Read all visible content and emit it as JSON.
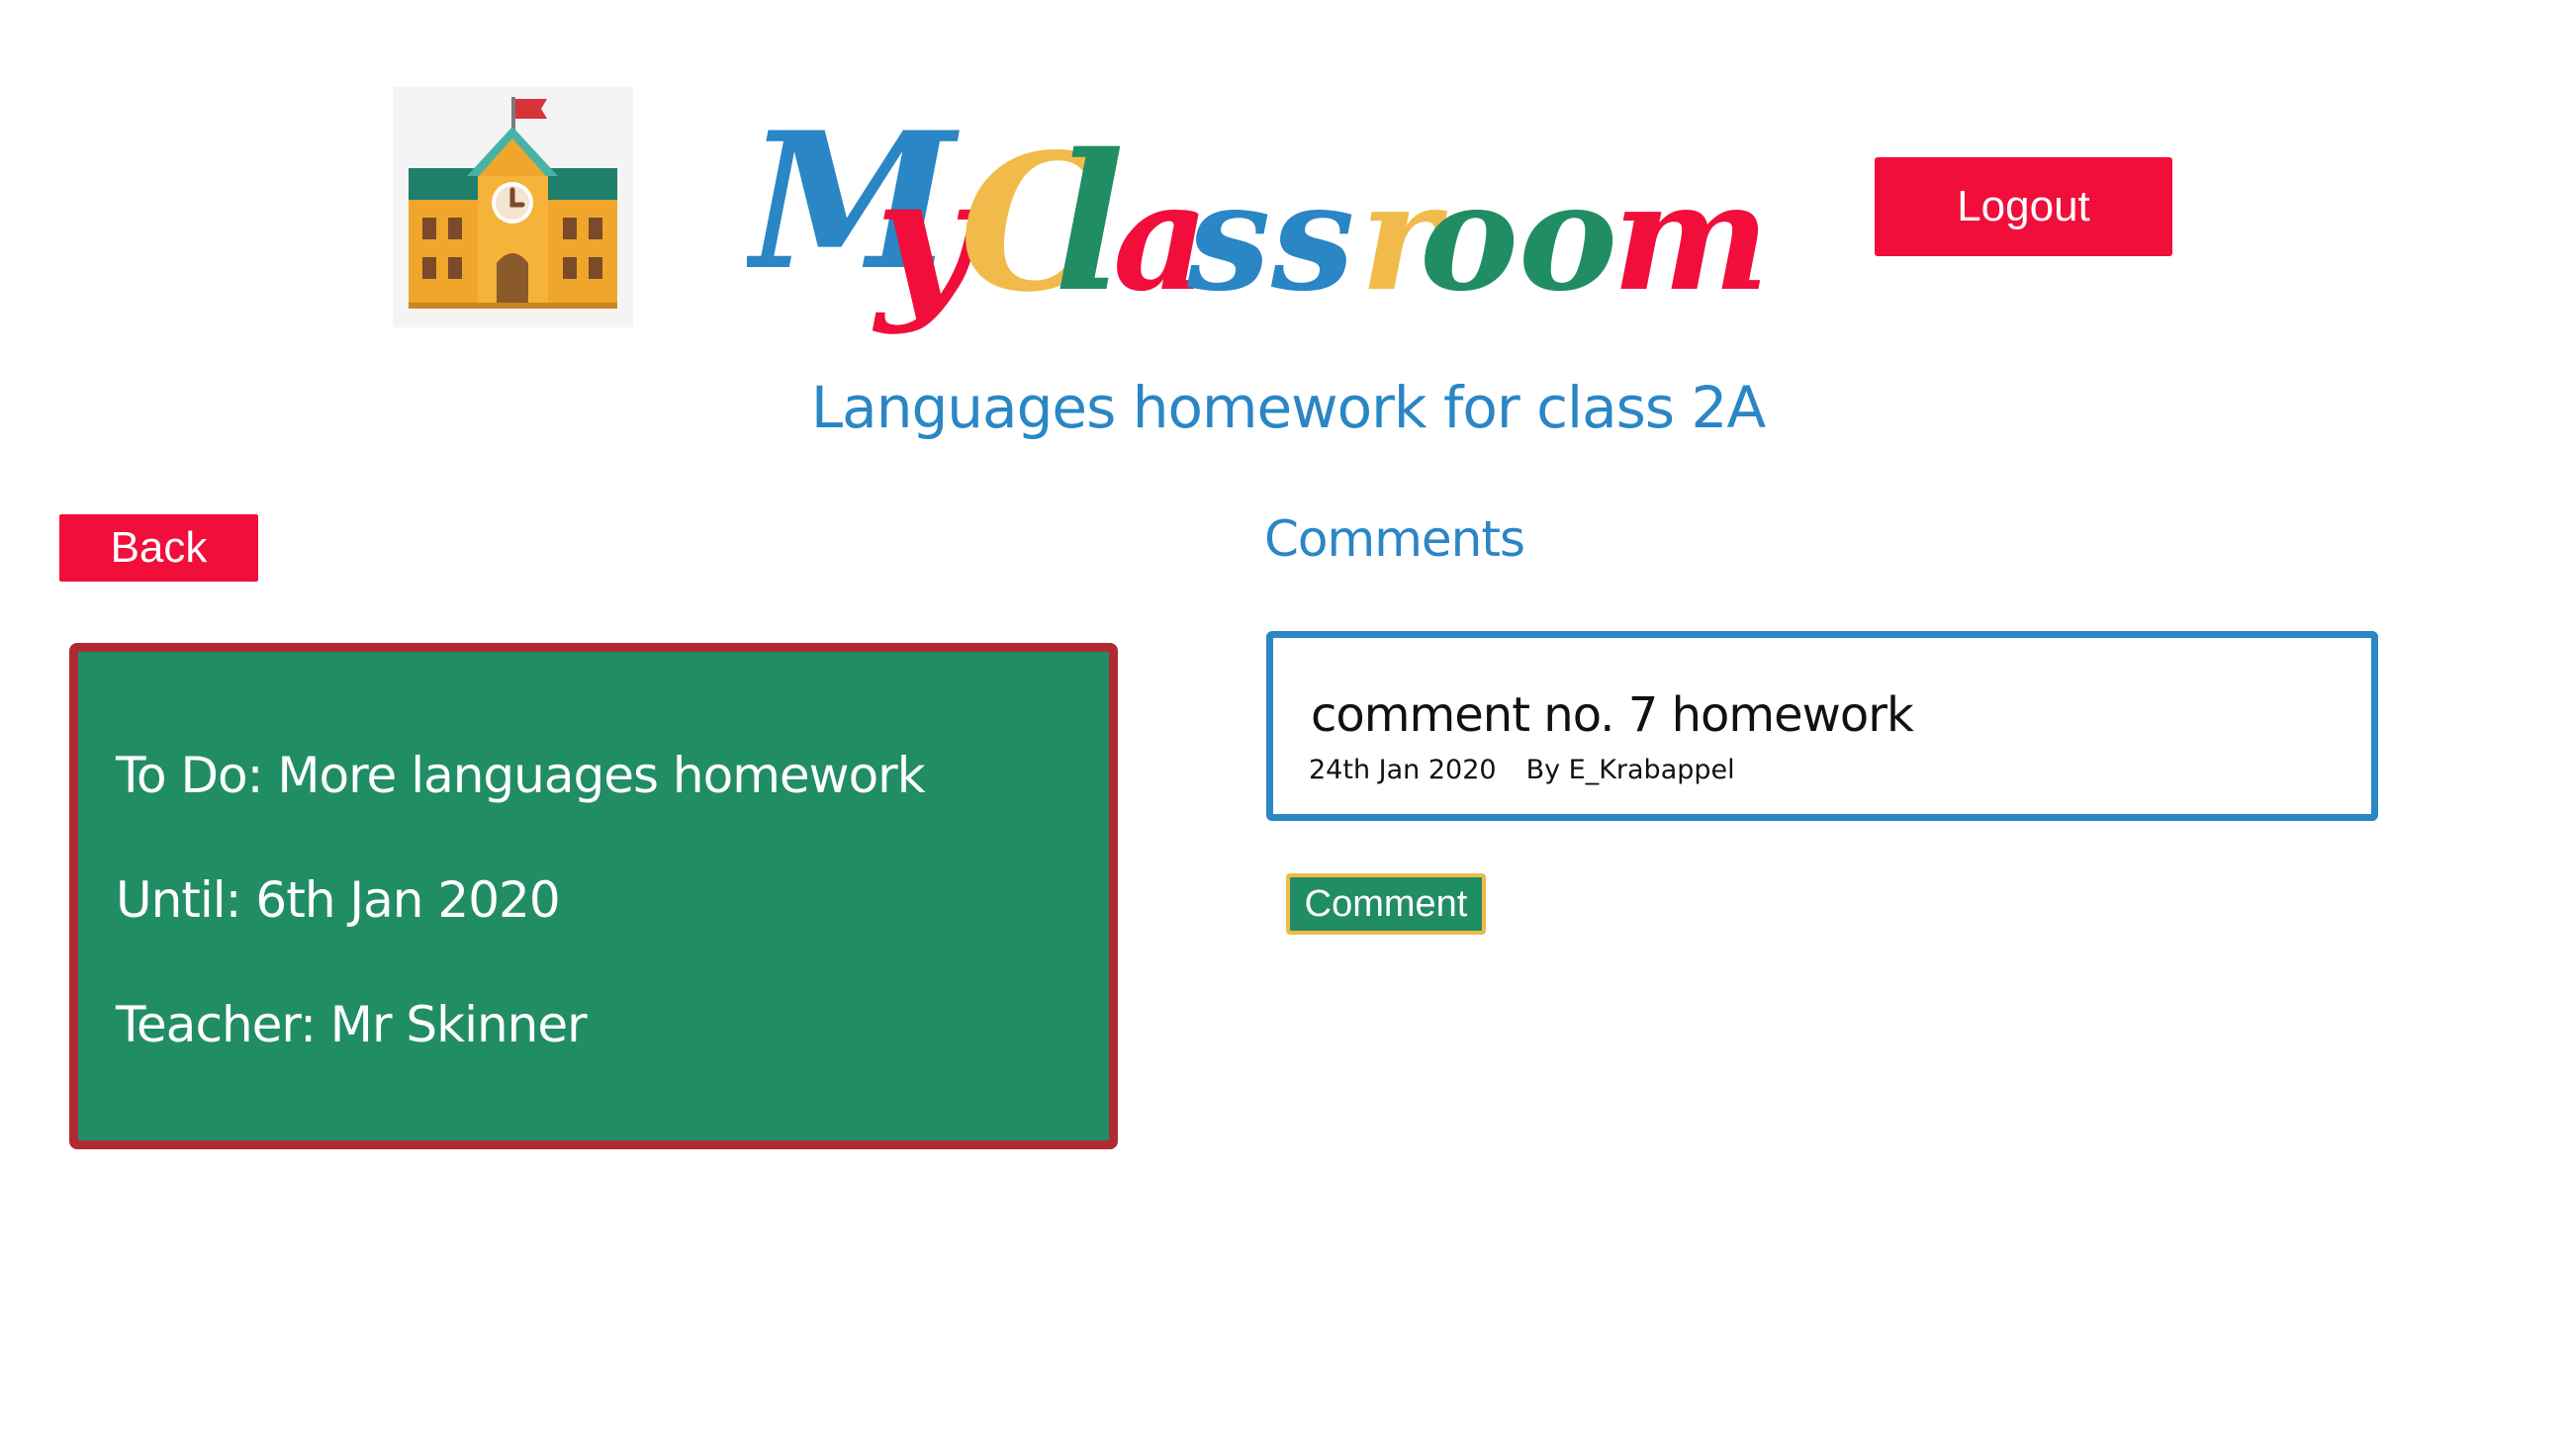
{
  "header": {
    "logo_letters": [
      {
        "char": "M",
        "color": "#2a86c5"
      },
      {
        "char": "y",
        "color": "#f10e3a"
      },
      {
        "char": "C",
        "color": "#f0bb4a"
      },
      {
        "char": "l",
        "color": "#218d65"
      },
      {
        "char": "a",
        "color": "#f10e3a"
      },
      {
        "char": "s",
        "color": "#2a86c5"
      },
      {
        "char": "s",
        "color": "#2a86c5"
      },
      {
        "char": "r",
        "color": "#f0bb4a"
      },
      {
        "char": "o",
        "color": "#218d65"
      },
      {
        "char": "o",
        "color": "#218d65"
      },
      {
        "char": "m",
        "color": "#f10e3a"
      }
    ],
    "logout_label": "Logout",
    "school_icon": "school-building-icon"
  },
  "page": {
    "title": "Languages homework for class 2A"
  },
  "homework": {
    "back_label": "Back",
    "todo": "To Do: More languages homework",
    "until": "Until: 6th Jan 2020",
    "teacher": "Teacher: Mr Skinner"
  },
  "comments": {
    "heading": "Comments",
    "items": [
      {
        "text": "comment no. 7 homework",
        "date": "24th Jan 2020",
        "author": "By E_Krabappel"
      }
    ],
    "comment_button_label": "Comment"
  },
  "colors": {
    "red": "#f10e3a",
    "blue": "#2a86c5",
    "green": "#218d65",
    "yellow": "#f0bb4a",
    "card_border": "#b12a33"
  }
}
